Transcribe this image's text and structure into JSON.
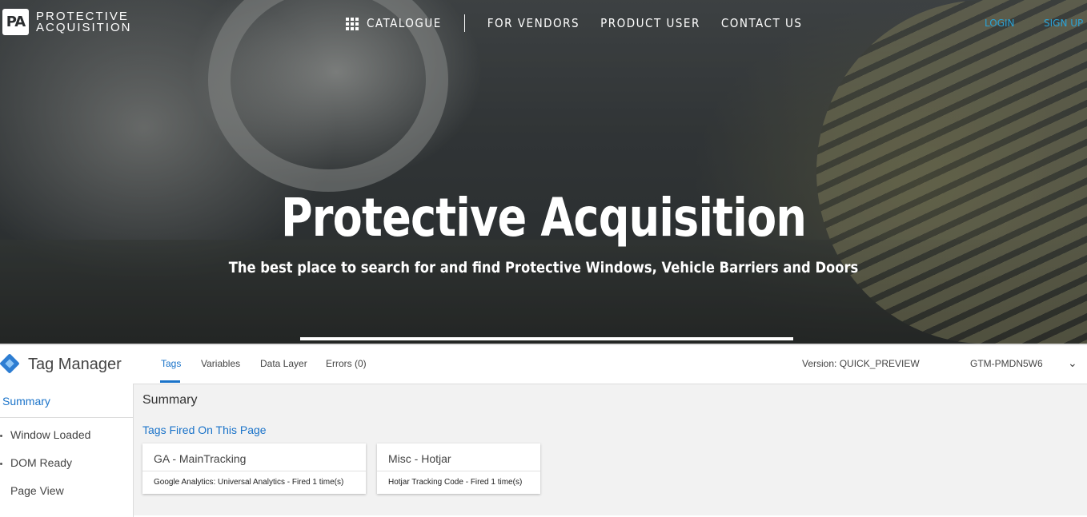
{
  "site": {
    "logo_mark": "PA",
    "logo_line1": "PROTECTIVE",
    "logo_line2": "ACQUISITION",
    "nav": {
      "catalogue": "CATALOGUE",
      "vendors": "FOR VENDORS",
      "product_user": "PRODUCT USER",
      "contact": "CONTACT US"
    },
    "login": "LOGIN",
    "signup": "SIGN UP",
    "hero_title": "Protective Acquisition",
    "hero_subtitle": "The best place to search for and find Protective Windows, Vehicle Barriers and Doors"
  },
  "tag_manager": {
    "title": "Tag Manager",
    "tabs": [
      "Tags",
      "Variables",
      "Data Layer",
      "Errors (0)"
    ],
    "version": "Version: QUICK_PREVIEW",
    "container_id": "GTM-PMDN5W6",
    "sidebar": {
      "summary": "Summary",
      "events": [
        "Window Loaded",
        "DOM Ready",
        "Page View"
      ]
    },
    "main_title": "Summary",
    "fired_heading": "Tags Fired On This Page",
    "tags": [
      {
        "name": "GA - MainTracking",
        "detail": "Google Analytics: Universal Analytics - Fired 1 time(s)"
      },
      {
        "name": "Misc - Hotjar",
        "detail": "Hotjar Tracking Code - Fired 1 time(s)"
      }
    ]
  },
  "colors": {
    "accent": "#1a73c9",
    "auth_link": "#2aa3d6"
  }
}
